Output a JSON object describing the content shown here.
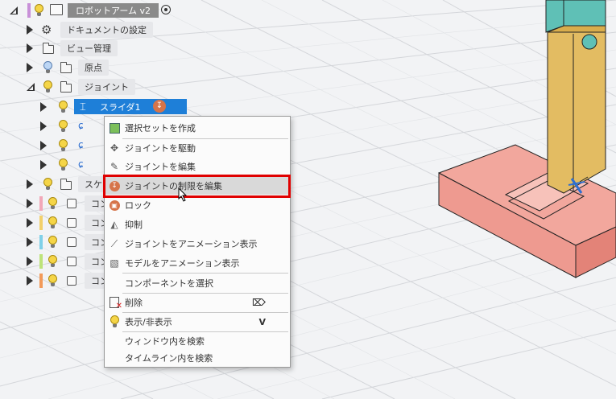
{
  "browser": {
    "root": {
      "label": "ロボットアーム v2"
    },
    "rows": [
      {
        "label": "ドキュメントの設定"
      },
      {
        "label": "ビュー管理"
      },
      {
        "label": "原点"
      },
      {
        "label": "ジョイント"
      },
      {
        "label": "スライダ1"
      },
      {
        "label": "スケ"
      },
      {
        "label": "コン",
        "color": "#f2a8b8"
      },
      {
        "label": "コン",
        "color": "#f2d06b"
      },
      {
        "label": "コン",
        "color": "#7fd0e8"
      },
      {
        "label": "コン",
        "color": "#bde37a"
      },
      {
        "label": "コン",
        "color": "#f29a5a"
      }
    ]
  },
  "context_menu": {
    "items": [
      {
        "label": "選択セットを作成",
        "icon": "selection-set-icon"
      },
      {
        "label": "ジョイントを駆動",
        "icon": "drive-joint-icon"
      },
      {
        "label": "ジョイントを編集",
        "icon": "edit-joint-icon"
      },
      {
        "label": "ジョイントの制限を編集",
        "icon": "joint-limits-icon"
      },
      {
        "label": "ロック",
        "icon": "lock-icon"
      },
      {
        "label": "抑制",
        "icon": "suppress-icon"
      },
      {
        "label": "ジョイントをアニメーション表示",
        "icon": "animate-joint-icon"
      },
      {
        "label": "モデルをアニメーション表示",
        "icon": "animate-model-icon"
      },
      {
        "label": "コンポーネントを選択"
      },
      {
        "label": "削除",
        "icon": "delete-icon"
      },
      {
        "label": "表示/非表示",
        "icon": "lightbulb-icon",
        "shortcut": "V"
      },
      {
        "label": "ウィンドウ内を検索"
      },
      {
        "label": "タイムライン内を検索"
      }
    ]
  },
  "colors": {
    "selection": "#1e7fd8",
    "part_tan": "#e3bc62",
    "part_teal": "#5fc0b6",
    "base_pink": "#f2a79d",
    "highlight": "#e00000"
  }
}
